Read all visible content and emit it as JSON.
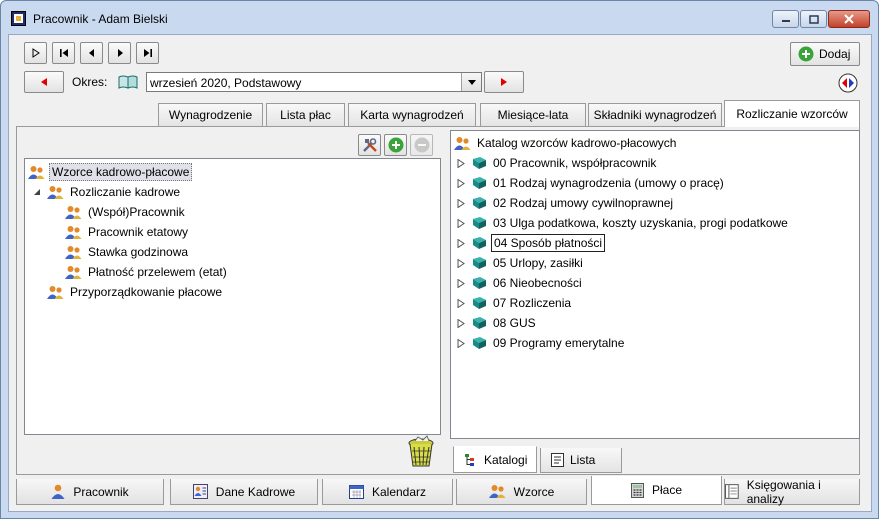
{
  "window": {
    "title": "Pracownik - Adam Bielski"
  },
  "toolbar": {
    "add_label": "Dodaj",
    "period_label": "Okres:",
    "period_value": "wrzesień 2020, Podstawowy"
  },
  "top_tabs": [
    {
      "label": "Wynagrodzenie"
    },
    {
      "label": "Lista płac"
    },
    {
      "label": "Karta wynagrodzeń"
    },
    {
      "label": "Miesiące-lata"
    },
    {
      "label": "Składniki wynagrodzeń"
    },
    {
      "label": "Rozliczanie wzorców"
    }
  ],
  "left_tree": {
    "nodes": [
      {
        "label": "Wzorce kadrowo-płacowe"
      },
      {
        "label": "Rozliczanie kadrowe"
      },
      {
        "label": "(Współ)Pracownik"
      },
      {
        "label": "Pracownik etatowy"
      },
      {
        "label": "Stawka godzinowa"
      },
      {
        "label": "Płatność przelewem (etat)"
      },
      {
        "label": "Przyporządkowanie płacowe"
      }
    ]
  },
  "right_tree": {
    "root": "Katalog wzorców kadrowo-płacowych",
    "items": [
      {
        "label": "00 Pracownik, współpracownik"
      },
      {
        "label": "01 Rodzaj wynagrodzenia (umowy o pracę)"
      },
      {
        "label": "02 Rodzaj umowy cywilnoprawnej"
      },
      {
        "label": "03 Ulga podatkowa, koszty uzyskania, progi podatkowe"
      },
      {
        "label": "04 Sposób płatności"
      },
      {
        "label": "05 Urlopy, zasiłki"
      },
      {
        "label": "06 Nieobecności"
      },
      {
        "label": "07 Rozliczenia"
      },
      {
        "label": "08 GUS"
      },
      {
        "label": "09 Programy emerytalne"
      }
    ]
  },
  "bottom_tabs": [
    {
      "label": "Katalogi"
    },
    {
      "label": "Lista"
    }
  ],
  "main_tabs": [
    {
      "label": "Pracownik"
    },
    {
      "label": "Dane Kadrowe"
    },
    {
      "label": "Kalendarz"
    },
    {
      "label": "Wzorce"
    },
    {
      "label": "Płace"
    },
    {
      "label": "Księgowania i analizy"
    }
  ],
  "colors": {
    "accent_red": "#e00000",
    "add_green": "#3aa33a",
    "book_teal": "#1a8a86",
    "person_orange": "#e08a2a"
  },
  "icons": {
    "people": "people-icon",
    "book": "book-icon",
    "expander": "triangle-icon"
  }
}
